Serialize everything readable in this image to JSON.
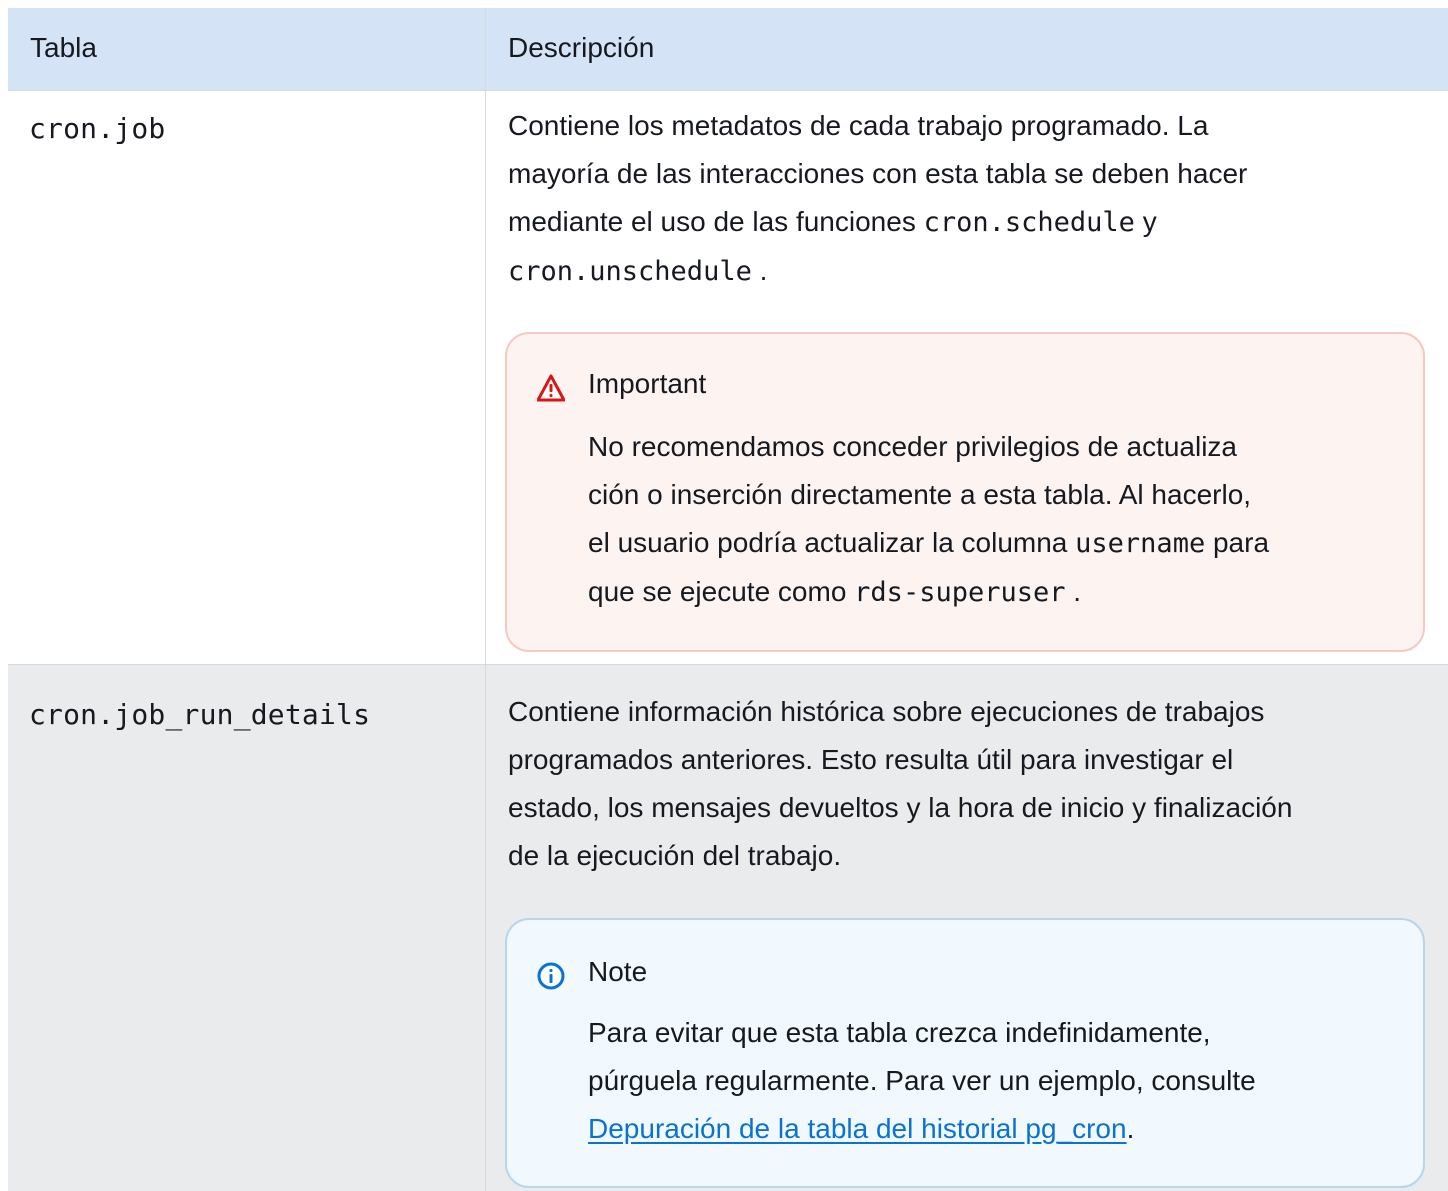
{
  "table": {
    "headers": {
      "col1": "Tabla",
      "col2": "Descripción"
    },
    "rows": [
      {
        "name": "cron.job",
        "desc_parts": {
          "line1": "Contiene los metadatos de cada trabajo programado. La",
          "line2": "mayoría de las interacciones con esta tabla se deben hacer",
          "line3_text": "mediante el uso de las funciones ",
          "line3_code": "cron.schedule",
          "line3_after": " y",
          "line4_code": "cron.unschedule",
          "line4_after": " ."
        },
        "alert": {
          "type": "warning",
          "icon": "warning-icon",
          "title": "Important",
          "line1": "No recomendamos conceder privilegios de actualiza",
          "line2": "ción o inserción directamente a esta tabla. Al hacerlo,",
          "line3_text": "el usuario podría actualizar la columna ",
          "line3_code": "username",
          "line3_after": " para",
          "line4_text": "que se ejecute como ",
          "line4_code": "rds-superuser",
          "line4_after": " ."
        }
      },
      {
        "name": "cron.job_run_details",
        "desc_parts": {
          "line1": "Contiene información histórica sobre ejecuciones de trabajos",
          "line2": "programados anteriores. Esto resulta útil para investigar el",
          "line3": "estado, los mensajes devueltos y la hora de inicio y finalización",
          "line4": "de la ejecución del trabajo."
        },
        "alert": {
          "type": "note",
          "icon": "info-icon",
          "title": "Note",
          "line1": "Para evitar que esta tabla crezca indefinidamente,",
          "line2": "púrguela regularmente. Para ver un ejemplo, consulte",
          "link": "Depuración de la tabla del historial pg_cron",
          "link_after": "."
        }
      }
    ]
  },
  "colors": {
    "header_bg": "#d4e4f6",
    "row_alt_bg": "#eaebec",
    "warning_bg": "#fdf3f1",
    "warning_border": "#f5c8c2",
    "warning_icon": "#d91515",
    "note_bg": "#f1f8fe",
    "note_border": "#b6d5ef",
    "note_icon": "#0972d3",
    "link": "#0972d3"
  }
}
